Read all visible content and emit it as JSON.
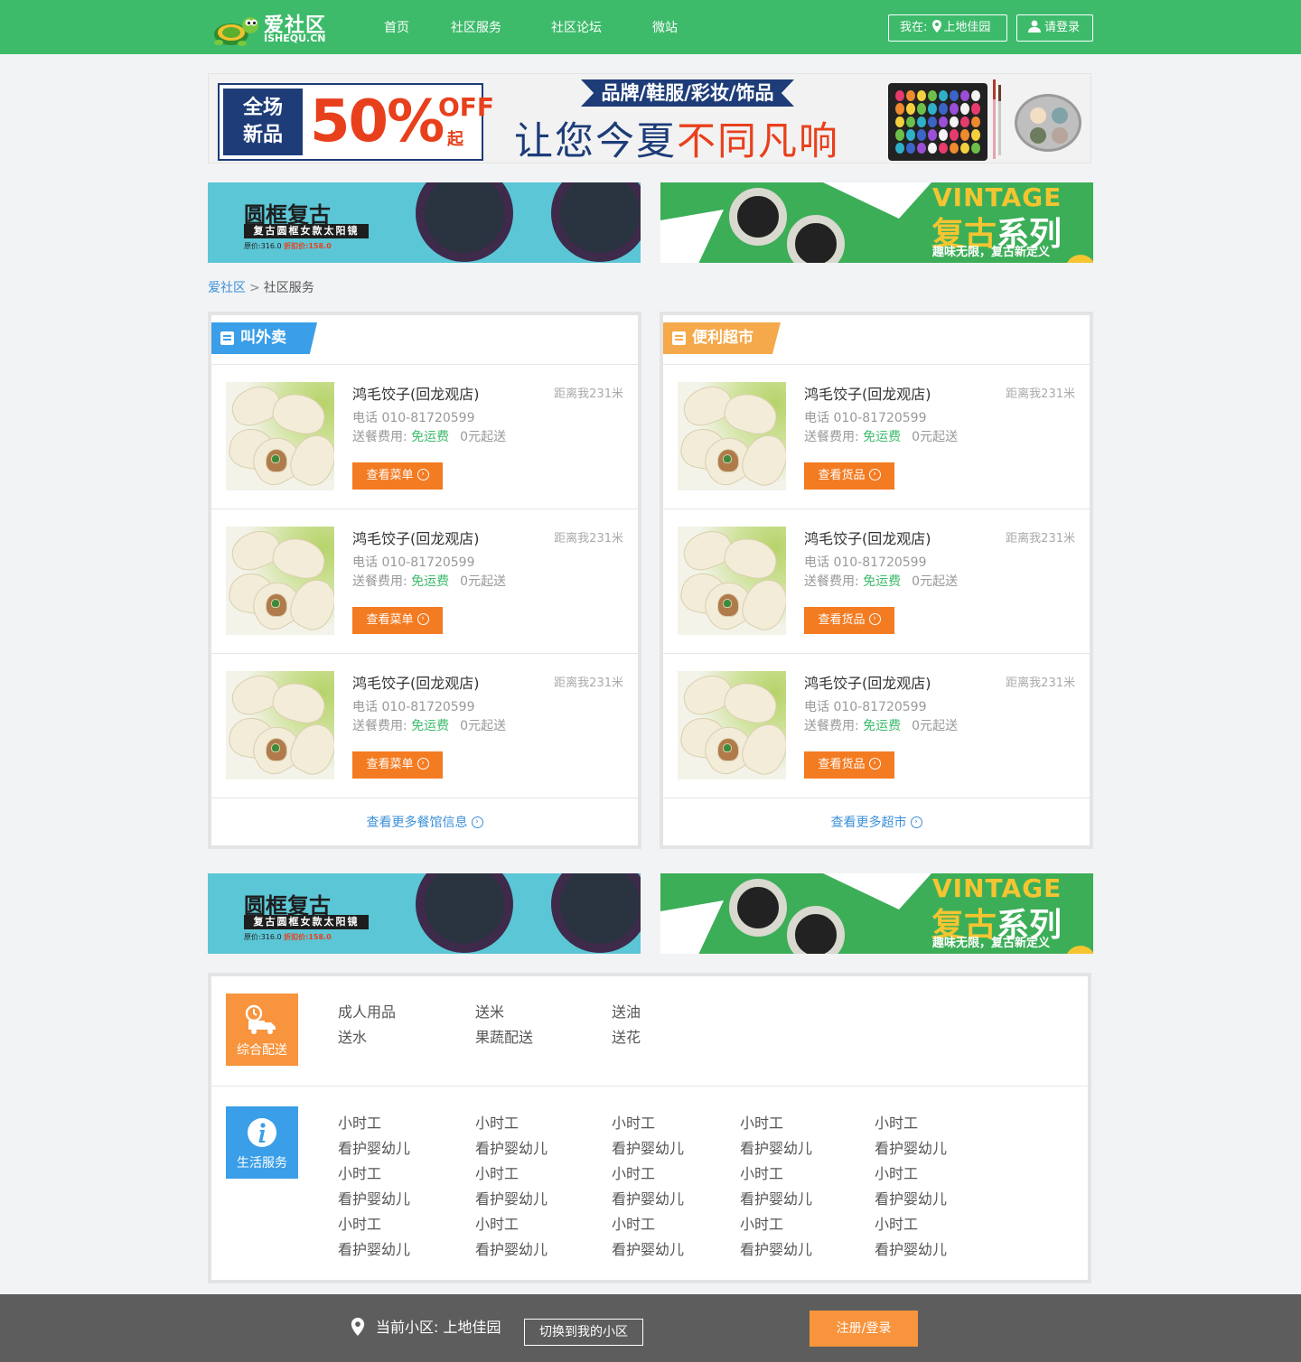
{
  "header": {
    "logo_text": "爱社区",
    "logo_sub": "ISHEQU.CN",
    "nav": [
      "首页",
      "社区服务",
      "社区论坛",
      "微站"
    ],
    "location_prefix": "我在:",
    "location": "上地佳园",
    "login": "请登录"
  },
  "banner_top": {
    "promo_left": "全场\n新品",
    "promo_big": "50%",
    "promo_off": "OFF",
    "promo_qi": "起",
    "ribbon": "品牌/鞋服/彩妆/饰品",
    "slogan_a": "让您今夏",
    "slogan_b": "不同凡响"
  },
  "ads": {
    "left": {
      "title": "圆框复古",
      "strip": "复古圆框女款太阳镜",
      "orig": "原价:316.0",
      "sale": "折扣价:158.0"
    },
    "right": {
      "vintage": "VINTAGE",
      "fugu_a": "复古",
      "fugu_b": "系列",
      "sub": "趣味无限，复古新定义"
    }
  },
  "breadcrumb": {
    "home": "爱社区",
    "sep": ">",
    "current": "社区服务"
  },
  "takeout": {
    "tag": "叫外卖",
    "tag_color": "#3a9ee8",
    "items": [
      {
        "name": "鸿毛饺子(回龙观店)",
        "distance": "距离我231米",
        "phone": "电话 010-81720599",
        "fee_label": "送餐费用:",
        "fee": "免运费",
        "min": "0元起送",
        "button": "查看菜单"
      },
      {
        "name": "鸿毛饺子(回龙观店)",
        "distance": "距离我231米",
        "phone": "电话 010-81720599",
        "fee_label": "送餐费用:",
        "fee": "免运费",
        "min": "0元起送",
        "button": "查看菜单"
      },
      {
        "name": "鸿毛饺子(回龙观店)",
        "distance": "距离我231米",
        "phone": "电话 010-81720599",
        "fee_label": "送餐费用:",
        "fee": "免运费",
        "min": "0元起送",
        "button": "查看菜单"
      }
    ],
    "more": "查看更多餐馆信息"
  },
  "market": {
    "tag": "便利超市",
    "tag_color": "#f5a94a",
    "items": [
      {
        "name": "鸿毛饺子(回龙观店)",
        "distance": "距离我231米",
        "phone": "电话 010-81720599",
        "fee_label": "送餐费用:",
        "fee": "免运费",
        "min": "0元起送",
        "button": "查看货品"
      },
      {
        "name": "鸿毛饺子(回龙观店)",
        "distance": "距离我231米",
        "phone": "电话 010-81720599",
        "fee_label": "送餐费用:",
        "fee": "免运费",
        "min": "0元起送",
        "button": "查看货品"
      },
      {
        "name": "鸿毛饺子(回龙观店)",
        "distance": "距离我231米",
        "phone": "电话 010-81720599",
        "fee_label": "送餐费用:",
        "fee": "免运费",
        "min": "0元起送",
        "button": "查看货品"
      }
    ],
    "more": "查看更多超市"
  },
  "delivery": {
    "label": "综合配送",
    "color": "#f7943d",
    "links": [
      "成人用品",
      "送米",
      "送油",
      "送水",
      "果蔬配送",
      "送花"
    ]
  },
  "life": {
    "label": "生活服务",
    "color": "#3a9ee8",
    "links": [
      "小时工",
      "小时工",
      "小时工",
      "小时工",
      "小时工",
      "看护婴幼儿",
      "看护婴幼儿",
      "看护婴幼儿",
      "看护婴幼儿",
      "看护婴幼儿",
      "小时工",
      "小时工",
      "小时工",
      "小时工",
      "小时工",
      "看护婴幼儿",
      "看护婴幼儿",
      "看护婴幼儿",
      "看护婴幼儿",
      "看护婴幼儿",
      "小时工",
      "小时工",
      "小时工",
      "小时工",
      "小时工",
      "看护婴幼儿",
      "看护婴幼儿",
      "看护婴幼儿",
      "看护婴幼儿",
      "看护婴幼儿"
    ]
  },
  "footer": {
    "current": "当前小区: 上地佳园",
    "switch": "切换到我的小区",
    "register": "注册/登录"
  }
}
